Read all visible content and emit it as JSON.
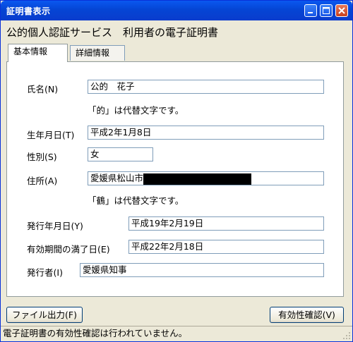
{
  "window": {
    "title": "証明書表示"
  },
  "heading": "公的個人認証サービス　利用者の電子証明書",
  "tabs": [
    {
      "label": "基本情報",
      "active": true
    },
    {
      "label": "詳細情報",
      "active": false
    }
  ],
  "fields": {
    "name": {
      "label": "氏名(N)",
      "value": "公的　花子"
    },
    "name_note": "「的」は代替文字です。",
    "birth": {
      "label": "生年月日(T)",
      "value": "平成2年1月8日"
    },
    "gender": {
      "label": "性別(S)",
      "value": "女"
    },
    "address": {
      "label": "住所(A)",
      "value": "愛媛県松山市"
    },
    "address_note": "「鶴」は代替文字です。",
    "issue_date": {
      "label": "発行年月日(Y)",
      "value": "平成19年2月19日"
    },
    "expiry": {
      "label": "有効期間の満了日(E)",
      "value": "平成22年2月18日"
    },
    "issuer": {
      "label": "発行者(I)",
      "value": "愛媛県知事"
    }
  },
  "buttons": {
    "file_output": "ファイル出力(F)",
    "validity_check": "有効性確認(V)"
  },
  "status": "電子証明書の有効性確認は行われていません。",
  "colors": {
    "titlebar": "#0545d4",
    "window_bg": "#ece9d8",
    "field_border": "#7f9db9"
  },
  "icons": {
    "minimize": "minimize-icon",
    "maximize": "maximize-icon",
    "close": "close-icon",
    "grip": "resize-grip-icon"
  }
}
